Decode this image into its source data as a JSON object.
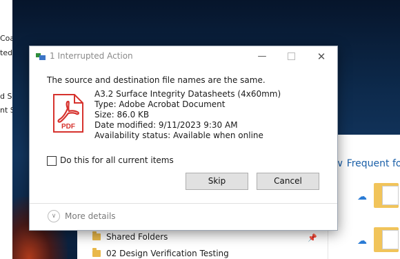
{
  "background": {
    "left_fragments": [
      "Coa",
      "ted",
      "d Sp",
      "nt S"
    ],
    "explorer_items": [
      "Shared Folders",
      "02 Design Verification Testing"
    ],
    "right_pane": {
      "heading": "Frequent fol"
    }
  },
  "dialog": {
    "title": "1 Interrupted Action",
    "message": "The source and destination file names are the same.",
    "file": {
      "name": "A3.2 Surface Integrity Datasheets (4x60mm)",
      "type": "Type: Adobe Acrobat Document",
      "size": "Size: 86.0 KB",
      "modified": "Date modified: 9/11/2023 9:30 AM",
      "availability": "Availability status: Available when online",
      "icon_label": "PDF"
    },
    "checkbox_label": "Do this for all current items",
    "checkbox_checked": false,
    "buttons": {
      "skip": "Skip",
      "cancel": "Cancel"
    },
    "more_details": "More details"
  },
  "colors": {
    "pdf_red": "#d6322d",
    "link_blue": "#1a5fa8",
    "cloud_blue": "#2a7bd5"
  }
}
